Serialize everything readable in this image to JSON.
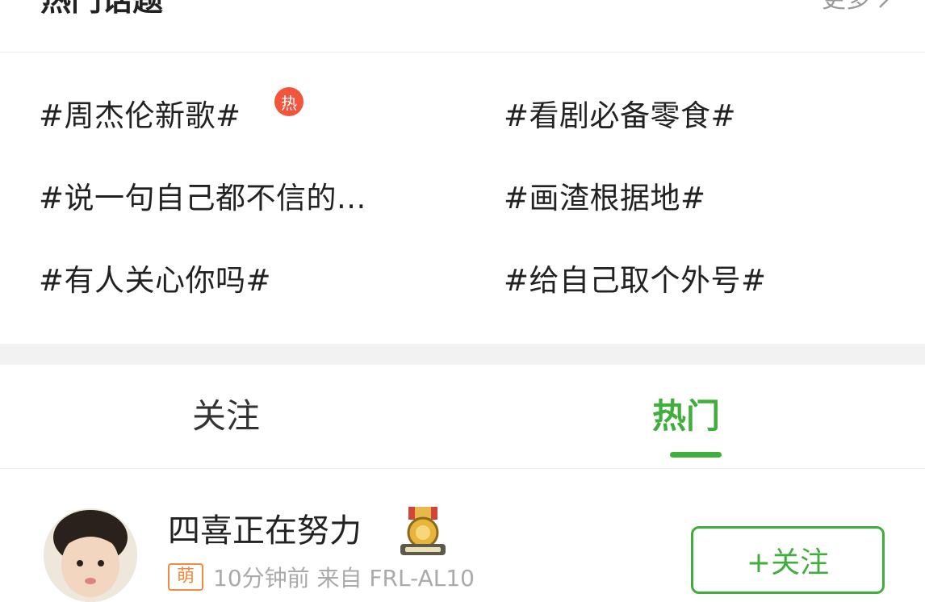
{
  "hot_topics": {
    "title": "热门话题",
    "more_label": "更多",
    "hot_badge": "热",
    "topics": [
      "#周杰伦新歌#",
      "#看剧必备零食#",
      "#说一句自己都不信的...",
      "#画渣根据地#",
      "#有人关心你吗#",
      "#给自己取个外号#"
    ]
  },
  "tabs": [
    {
      "label": "关注",
      "active": false
    },
    {
      "label": "热门",
      "active": true
    }
  ],
  "post": {
    "username": "四喜正在努力",
    "level_badge": "萌",
    "meta": "10分钟前 来自 FRL-AL10",
    "follow_label": "+关注"
  },
  "colors": {
    "accent": "#3fae3a",
    "hot_badge": "#f2553b",
    "level_badge": "#f08a3c",
    "muted_text": "#999999"
  },
  "icons": {
    "more": "chevron-right-icon",
    "medal": "medal-icon",
    "avatar": "user-avatar"
  }
}
